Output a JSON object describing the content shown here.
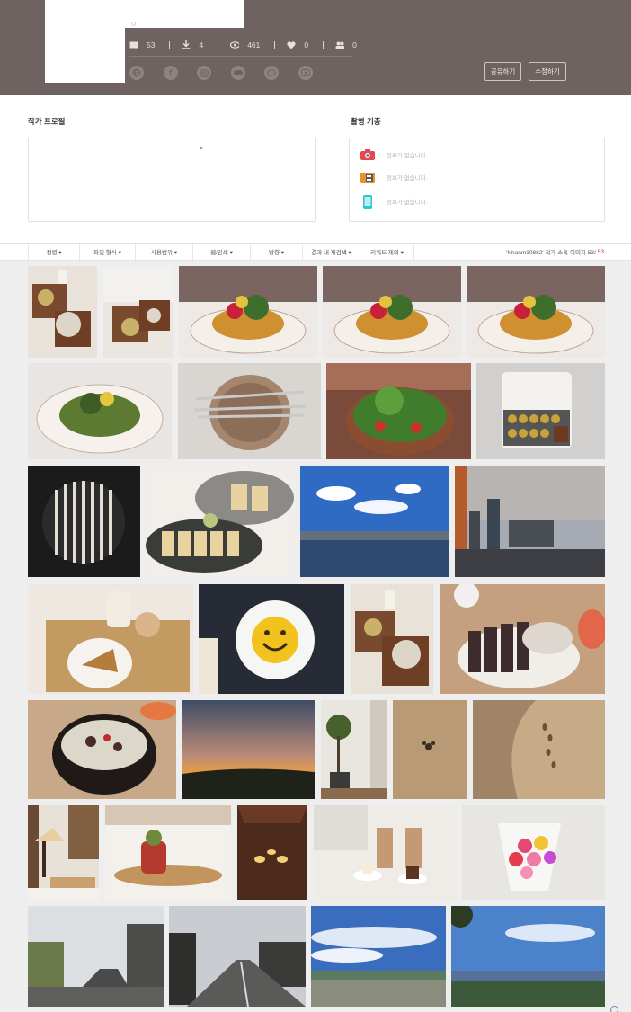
{
  "header": {
    "stats": [
      {
        "icon": "photo-icon",
        "value": "53"
      },
      {
        "icon": "download-icon",
        "value": "4"
      },
      {
        "icon": "eye-icon",
        "value": "461"
      },
      {
        "icon": "heart-icon",
        "value": "0"
      },
      {
        "icon": "followers-icon",
        "value": "0"
      }
    ],
    "socials": [
      "globe-icon",
      "facebook-icon",
      "instagram-icon",
      "blog-icon",
      "chat-icon",
      "youtube-icon"
    ],
    "share_label": "공유하기",
    "edit_label": "수정하기",
    "background_color": "#6e6360"
  },
  "profile": {
    "title": "작가 프로필"
  },
  "gear": {
    "title": "촬영 기종",
    "items": [
      {
        "icon": "camera-icon",
        "text": "정보가 없습니다."
      },
      {
        "icon": "film-camera-icon",
        "text": "정보가 없습니다."
      },
      {
        "icon": "smartphone-icon",
        "text": "정보가 없습니다."
      }
    ]
  },
  "filters": [
    {
      "label": "정렬 ▾"
    },
    {
      "label": "파일 형식 ▾"
    },
    {
      "label": "사용범위 ▾"
    },
    {
      "label": "웹/인쇄 ▾"
    },
    {
      "label": "방향 ▾"
    },
    {
      "label": "결과 내 재검색 ▾"
    },
    {
      "label": "키워드 제외 ▾"
    }
  ],
  "result": {
    "prefix": "'Nhanm30882' 작가 스톡 이미지 53/",
    "total": "53"
  }
}
